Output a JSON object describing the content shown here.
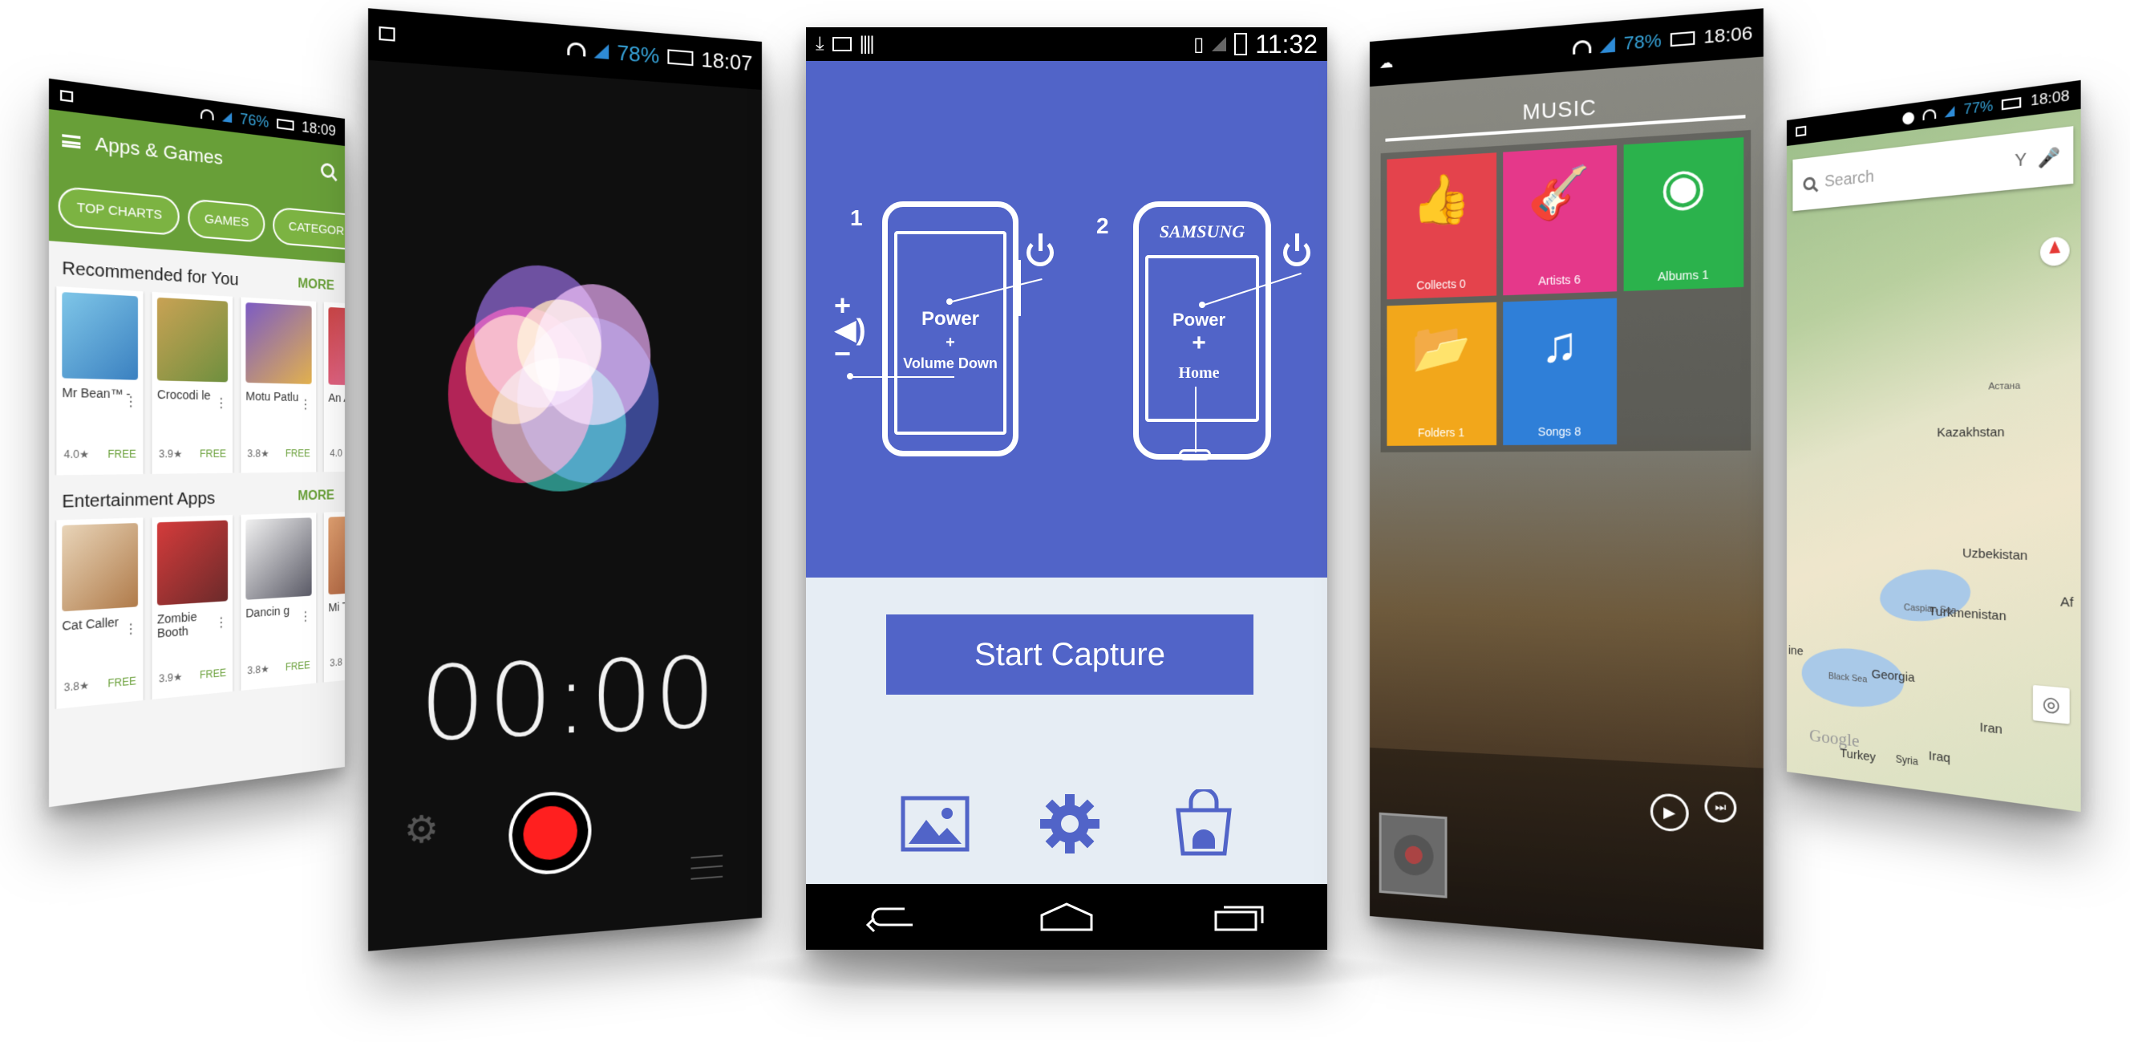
{
  "playstore": {
    "status": {
      "battery_pct": "76%",
      "time": "18:09"
    },
    "toolbar_title": "Apps & Games",
    "chips": [
      "TOP CHARTS",
      "GAMES",
      "CATEGORIES"
    ],
    "sections": [
      {
        "title": "Recommended for You",
        "more": "MORE",
        "apps": [
          {
            "name": "Mr Bean™ -",
            "rating": "4.0★",
            "price": "FREE"
          },
          {
            "name": "Crocodi le",
            "rating": "3.9★",
            "price": "FREE"
          },
          {
            "name": "Motu Patlu",
            "rating": "3.8★",
            "price": "FREE"
          },
          {
            "name": "An An",
            "rating": "4.0",
            "price": ""
          }
        ]
      },
      {
        "title": "Entertainment Apps",
        "more": "MORE",
        "apps": [
          {
            "name": "Cat Caller",
            "rating": "3.8★",
            "price": "FREE"
          },
          {
            "name": "Zombie Booth",
            "rating": "3.9★",
            "price": "FREE"
          },
          {
            "name": "Dancin g",
            "rating": "3.8★",
            "price": "FREE"
          },
          {
            "name": "Mi Th",
            "rating": "3.8",
            "price": ""
          }
        ]
      }
    ]
  },
  "recorder": {
    "status": {
      "battery_pct": "78%",
      "time": "18:07"
    },
    "timer": "00:00"
  },
  "capture": {
    "status": {
      "time": "11:32"
    },
    "steps": [
      {
        "number": "1",
        "power": "Power",
        "plus": "+",
        "combo": "Volume Down"
      },
      {
        "number": "2",
        "brand": "SAMSUNG",
        "power": "Power",
        "plus": "+",
        "combo": "Home"
      }
    ],
    "start_button": "Start Capture",
    "accent_color": "#5164c8"
  },
  "music": {
    "status": {
      "battery_pct": "78%",
      "time": "18:06"
    },
    "title": "MUSIC",
    "tiles": [
      {
        "label": "Collects 0",
        "color": "#e4434c",
        "icon": "thumbs-up-icon"
      },
      {
        "label": "Artists 6",
        "color": "#e5388a",
        "icon": "guitar-icon"
      },
      {
        "label": "Albums 1",
        "color": "#2bb24c",
        "icon": "vinyl-icon"
      },
      {
        "label": "Folders 1",
        "color": "#f2a71b",
        "icon": "folder-icon"
      },
      {
        "label": "Songs 8",
        "color": "#2f7fd8",
        "icon": "music-note-icon"
      }
    ]
  },
  "maps": {
    "status": {
      "battery_pct": "77%",
      "time": "18:08"
    },
    "search_placeholder": "Search",
    "places": [
      "Kazakhstan",
      "Uzbekistan",
      "Turkmenistan",
      "Georgia",
      "Iran",
      "Turkey",
      "Syria",
      "Iraq"
    ],
    "small_places": [
      "Астана",
      "Caspian Sea",
      "Black Sea",
      "ine",
      "Af"
    ],
    "logo": "Google"
  }
}
